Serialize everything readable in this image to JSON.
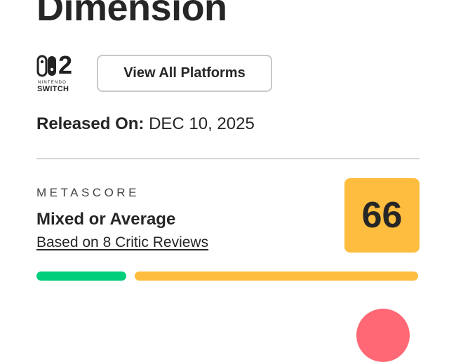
{
  "game": {
    "title": "Dimension"
  },
  "platform": {
    "logo_number": "2",
    "logo_brand": "NINTENDO",
    "logo_word": "SWITCH",
    "view_all_label": "View All Platforms"
  },
  "release": {
    "label": "Released On:",
    "date": "DEC 10, 2025"
  },
  "metascore": {
    "label": "METASCORE",
    "verdict": "Mixed or Average",
    "reviews_link": "Based on 8 Critic Reviews",
    "score": "66",
    "distribution": {
      "positive_fraction": 0.24,
      "mixed_fraction": 0.76
    }
  },
  "colors": {
    "score_box": "#ffbd3f",
    "positive_bar": "#00ce7a",
    "mixed_bar": "#ffbd3f",
    "negative_circle": "#ff6874",
    "divider": "#d6d6d6"
  }
}
